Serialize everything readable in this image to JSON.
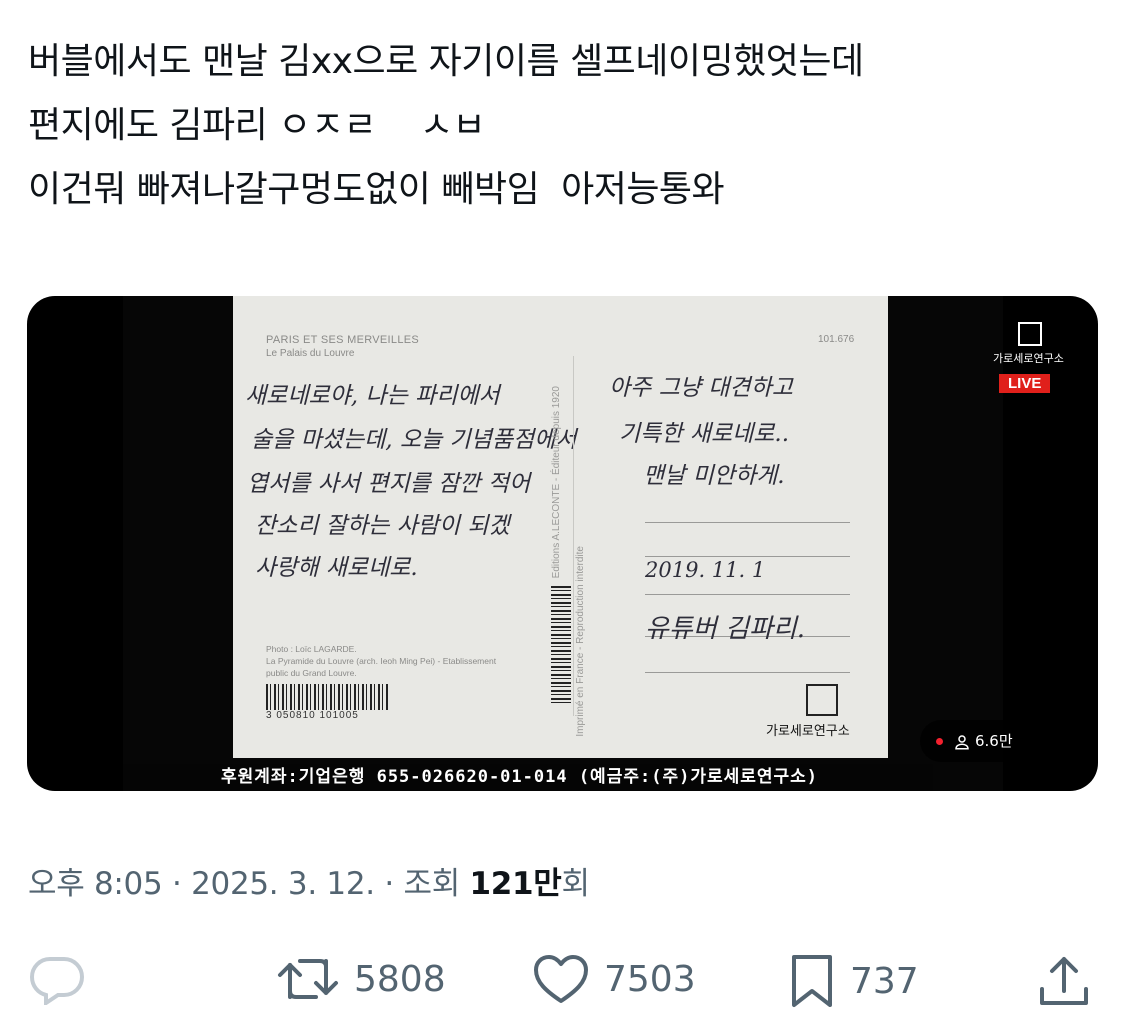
{
  "tweet": {
    "lines": [
      "버블에서도 맨날 김xx으로 자기이름 셀프네이밍했엇는데",
      "편지에도 김파리 ㅇㅈㄹ    ㅅㅂ",
      "이건뭐 빠져나갈구멍도없이 빼박임  아저능통와"
    ]
  },
  "video": {
    "postcard": {
      "title": "PARIS ET SES MERVEILLES",
      "subtitle": "Le Palais du Louvre",
      "code": "101.676",
      "handwriting_left": [
        "새로네로야, 나는 파리에서",
        "술을 마셨는데, 오늘 기념품점에서",
        "엽서를 사서 편지를 잠깐 적어",
        "잔소리 잘하는 사람이 되겠",
        "사랑해 새로네로."
      ],
      "handwriting_right": [
        "아주 그냥 대견하고",
        "기특한 새로네로..",
        "맨날 미안하게."
      ],
      "date": "2019. 11. 1",
      "signature": "유튜버 김파리.",
      "vertical_text": "Editions A.LECONTE - Éditeur depuis 1920",
      "vertical_text2": "Imprimé en France - Reproduction interdite",
      "photo_credit": "Photo : Loïc LAGARDE.\nLa Pyramide du Louvre (arch. Ieoh Ming Pei) - Etablissement\npublic du Grand Louvre.",
      "barcode_number": "3 050810 101005",
      "logo_text": "가로세로연구소"
    },
    "channel_name": "가로세로연구소",
    "live_label": "LIVE",
    "ticker": "후원계좌:기업은행 655-026620-01-014 (예금주:(주)가로세로연구소)",
    "viewer_count": "6.6만"
  },
  "meta": {
    "time": "오후 8:05",
    "sep": " · ",
    "date": "2025. 3. 12.",
    "views_label": "조회 ",
    "views_count": "121만",
    "views_suffix": "회"
  },
  "actions": {
    "retweets": "5808",
    "likes": "7503",
    "bookmarks": "737"
  },
  "colors": {
    "text": "#0f1419",
    "muted": "#536471",
    "live": "#e0201b"
  }
}
